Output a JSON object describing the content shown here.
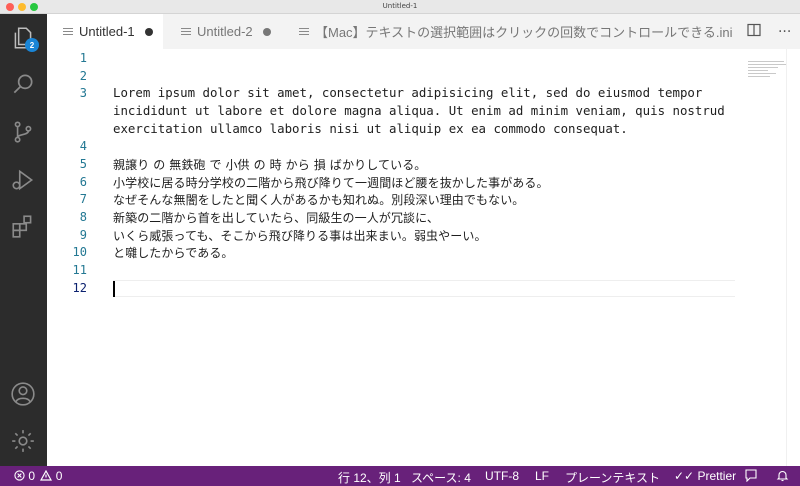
{
  "window": {
    "title": "Untitled-1"
  },
  "activity_bar": {
    "items": [
      {
        "name": "explorer-icon",
        "badge": "2"
      },
      {
        "name": "search-icon"
      },
      {
        "name": "source-control-icon"
      },
      {
        "name": "run-debug-icon"
      },
      {
        "name": "extensions-icon"
      }
    ],
    "bottom": [
      {
        "name": "account-icon"
      },
      {
        "name": "manage-gear-icon"
      }
    ]
  },
  "tabs": [
    {
      "label": "Untitled-1",
      "active": true,
      "dirty": true
    },
    {
      "label": "Untitled-2",
      "active": false,
      "dirty": true
    },
    {
      "label": "【Mac】テキストの選択範囲はクリックの回数でコントロールできる.ini",
      "active": false,
      "dirty": false
    }
  ],
  "tab_actions": {
    "split": "split-editor-icon",
    "more": "···"
  },
  "editor": {
    "line_numbers": [
      "1",
      "2",
      "3",
      "",
      "",
      "4",
      "5",
      "6",
      "7",
      "8",
      "9",
      "10",
      "11",
      "12"
    ],
    "lines": [
      "",
      "",
      "Lorem ipsum dolor sit amet, consectetur adipisicing elit, sed do eiusmod tempor",
      "incididunt ut labore et dolore magna aliqua. Ut enim ad minim veniam, quis nostrud",
      "exercitation ullamco laboris nisi ut aliquip ex ea commodo consequat.",
      "",
      "親譲り の 無鉄砲 で 小供 の 時 から 損 ばかりしている。",
      "小学校に居る時分学校の二階から飛び降りて一週間ほど腰を抜かした事がある。",
      "なぜそんな無闇をしたと聞く人があるかも知れぬ。別段深い理由でもない。",
      "新築の二階から首を出していたら、同級生の一人が冗談に、",
      "いくら威張っても、そこから飛び降りる事は出来まい。弱虫やーい。",
      "と囃したからである。",
      "",
      ""
    ]
  },
  "status_bar": {
    "errors": "0",
    "warnings": "0",
    "position": "行 12、列 1",
    "spaces": "スペース: 4",
    "encoding": "UTF-8",
    "eol": "LF",
    "language": "プレーンテキスト",
    "prettier": "Prettier",
    "color": "#68217a"
  }
}
